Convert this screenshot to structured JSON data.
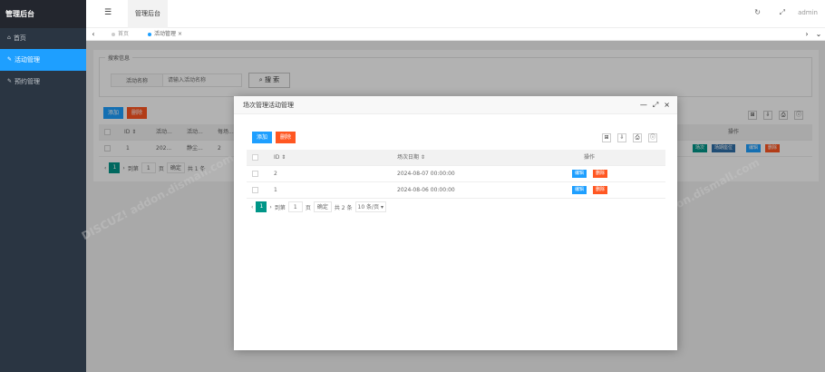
{
  "app": {
    "title": "管理后台"
  },
  "sidebar": {
    "items": [
      {
        "icon": "home-icon",
        "glyph": "⌂",
        "label": "首页"
      },
      {
        "icon": "edit-icon",
        "glyph": "✎",
        "label": "活动管理"
      },
      {
        "icon": "edit-icon",
        "glyph": "✎",
        "label": "预约管理"
      }
    ]
  },
  "header": {
    "menu_glyph": "☰",
    "title": "管理后台",
    "refresh_glyph": "↻",
    "fullscreen_glyph": "⤢",
    "user": "admin"
  },
  "tabs": {
    "prev_glyph": "‹",
    "next_glyph": "›",
    "more_glyph": "⌄",
    "items": [
      {
        "label": "首页"
      },
      {
        "label": "活动管理",
        "close": "×"
      }
    ]
  },
  "search": {
    "legend": "搜索信息",
    "field_label": "活动名称",
    "placeholder": "请输入活动名称",
    "button_label": "搜 索",
    "button_glyph": "⌕"
  },
  "toolbar": {
    "add": "添加",
    "delete": "删除"
  },
  "bg_table": {
    "headers": [
      "ID ⇕",
      "活动...",
      "活动...",
      "每场..."
    ],
    "ops_header": "操作",
    "row": {
      "id": "1",
      "col1": "202...",
      "col2": "静尘...",
      "col3": "2"
    },
    "row_buttons": [
      "场次",
      "场期座位",
      "编辑",
      "删除"
    ]
  },
  "bg_pager": {
    "page": "1",
    "goto": "到第",
    "page_input": "1",
    "page_unit": "页",
    "confirm": "确定",
    "total": "共 1 条"
  },
  "modal": {
    "title": "场次管理活动管理",
    "add": "添加",
    "delete": "删除",
    "headers": [
      "ID ⇕",
      "场次日期 ⇕",
      "操作"
    ],
    "rows": [
      {
        "id": "2",
        "date": "2024-08-07 00:00:00"
      },
      {
        "id": "1",
        "date": "2024-08-06 00:00:00"
      }
    ],
    "row_buttons": [
      "编辑",
      "删除"
    ],
    "tools": [
      "⊞",
      "⇩",
      "⎙",
      "ⓘ"
    ],
    "controls": {
      "minimize": "—",
      "maximize": "⤢",
      "close": "×"
    },
    "pager": {
      "prev": "‹",
      "page": "1",
      "next": "›",
      "goto": "到第",
      "page_input": "1",
      "page_unit": "页",
      "confirm": "确定",
      "total": "共 2 条",
      "per_page": "10 条/页 ▾"
    }
  },
  "colors": {
    "sidebar": "#2a3542",
    "active": "#1e9fff",
    "danger": "#ff5722",
    "teal": "#009688"
  }
}
